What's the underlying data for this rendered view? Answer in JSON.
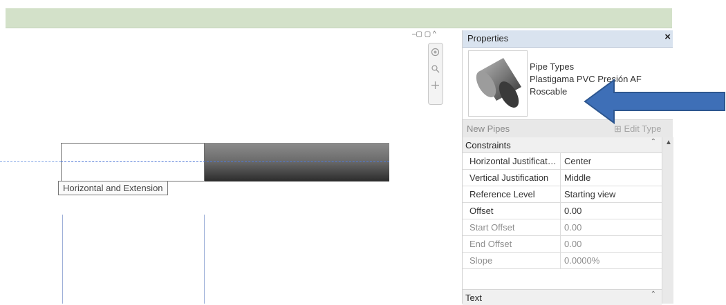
{
  "canvas": {
    "tooltip": "Horizontal and Extension",
    "view_controls": "–▢ ▢ ^",
    "navbar_icons": [
      "wheel-icon",
      "zoom-icon",
      "pan-icon"
    ]
  },
  "properties": {
    "title": "Properties",
    "close": "×",
    "type_selector": {
      "family": "Pipe Types",
      "type_line1": "Plastigama PVC Presión AF",
      "type_line2": "Roscable",
      "dropdown": "▾"
    },
    "instance_label": "New Pipes",
    "edit_type": "⊞ Edit Type",
    "sections": [
      {
        "name": "Constraints",
        "rows": [
          {
            "name": "Horizontal Justification",
            "value": "Center",
            "enabled": true
          },
          {
            "name": "Vertical Justification",
            "value": "Middle",
            "enabled": true
          },
          {
            "name": "Reference Level",
            "value": "Starting view",
            "enabled": true
          },
          {
            "name": "Offset",
            "value": "0.00",
            "enabled": true
          },
          {
            "name": "Start Offset",
            "value": "0.00",
            "enabled": false
          },
          {
            "name": "End Offset",
            "value": "0.00",
            "enabled": false
          },
          {
            "name": "Slope",
            "value": "0.0000%",
            "enabled": false
          }
        ]
      },
      {
        "name": "Text",
        "rows": []
      }
    ],
    "collapse_icon": "⌃"
  },
  "colors": {
    "ribbon": "#d3e1c9",
    "callout_arrow": "#3e6fb7",
    "header": "#d9e3ef"
  }
}
